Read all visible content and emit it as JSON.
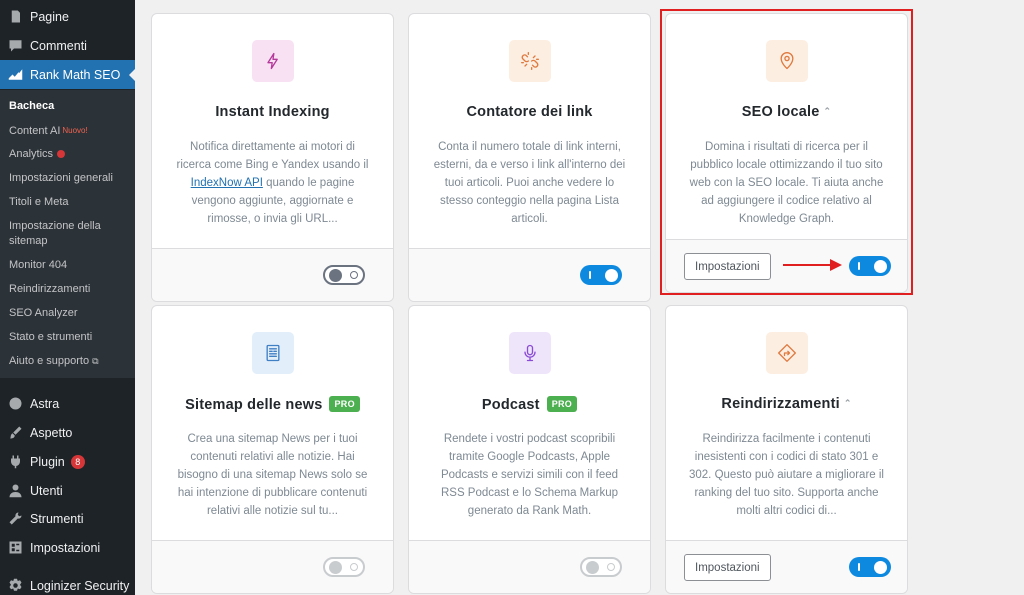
{
  "sidebar": {
    "items": [
      {
        "label": "Pagine",
        "icon": "page-icon"
      },
      {
        "label": "Commenti",
        "icon": "comment-icon"
      },
      {
        "label": "Rank Math SEO",
        "icon": "rank-math-icon"
      }
    ],
    "submenu": [
      {
        "label": "Bacheca"
      },
      {
        "label": "Content AI",
        "badge": "Nuovo!"
      },
      {
        "label": "Analytics"
      },
      {
        "label": "Impostazioni generali"
      },
      {
        "label": "Titoli e Meta"
      },
      {
        "label": "Impostazione della sitemap"
      },
      {
        "label": "Monitor 404"
      },
      {
        "label": "Reindirizzamenti"
      },
      {
        "label": "SEO Analyzer"
      },
      {
        "label": "Stato e strumenti"
      },
      {
        "label": "Aiuto e supporto"
      }
    ],
    "items2": [
      {
        "label": "Astra",
        "icon": "astra-icon"
      },
      {
        "label": "Aspetto",
        "icon": "brush-icon"
      },
      {
        "label": "Plugin",
        "icon": "plugin-icon",
        "count": "8"
      },
      {
        "label": "Utenti",
        "icon": "user-icon"
      },
      {
        "label": "Strumenti",
        "icon": "wrench-icon"
      },
      {
        "label": "Impostazioni",
        "icon": "settings-icon"
      },
      {
        "label": "Loginizer Security",
        "icon": "gear-icon"
      }
    ]
  },
  "cards": [
    {
      "title": "Instant Indexing",
      "desc_before": "Notifica direttamente ai motori di ricerca come Bing e Yandex usando il ",
      "desc_link": "IndexNow API",
      "desc_after": " quando le pagine vengono aggiunte, aggiornate e rimosse, o invia gli URL...",
      "toggle": "off",
      "icon": "lightning-icon",
      "icon_color": "#b5399b",
      "icon_bg": "#f8e1f3"
    },
    {
      "title": "Contatore dei link",
      "desc": "Conta il numero totale di link interni, esterni, da e verso i link all'interno dei tuoi articoli. Puoi anche vedere lo stesso conteggio nella pagina Lista articoli.",
      "toggle": "on",
      "icon": "link-broken-icon",
      "icon_color": "#e07a3f",
      "icon_bg": "#fdeee2"
    },
    {
      "title": "SEO locale",
      "desc": "Domina i risultati di ricerca per il pubblico locale ottimizzando il tuo sito web con la SEO locale. Ti aiuta anche ad aggiungere il codice relativo al Knowledge Graph.",
      "toggle": "on",
      "settings_label": "Impostazioni",
      "icon": "location-pin-icon",
      "icon_color": "#e07a3f",
      "icon_bg": "#fdeee2"
    },
    {
      "title": "Sitemap delle news",
      "pro": "PRO",
      "desc": "Crea una sitemap News per i tuoi contenuti relativi alle notizie. Hai bisogno di una sitemap News solo se hai intenzione di pubblicare contenuti relativi alle notizie sul tu...",
      "toggle": "disabled",
      "icon": "newspaper-icon",
      "icon_color": "#3f7fc4",
      "icon_bg": "#e3eefb"
    },
    {
      "title": "Podcast",
      "pro": "PRO",
      "desc": "Rendete i vostri podcast scopribili tramite Google Podcasts, Apple Podcasts e servizi simili con il feed RSS Podcast e lo Schema Markup generato da Rank Math.",
      "toggle": "disabled",
      "icon": "microphone-icon",
      "icon_color": "#8a4bd6",
      "icon_bg": "#efe5fb"
    },
    {
      "title": "Reindirizzamenti",
      "desc": "Reindirizza facilmente i contenuti inesistenti con i codici di stato 301 e 302. Questo può aiutare a migliorare il ranking del tuo sito. Supporta anche molti altri codici di...",
      "toggle": "on",
      "settings_label": "Impostazioni",
      "icon": "redirect-sign-icon",
      "icon_color": "#e07a3f",
      "icon_bg": "#fdeee2"
    }
  ]
}
